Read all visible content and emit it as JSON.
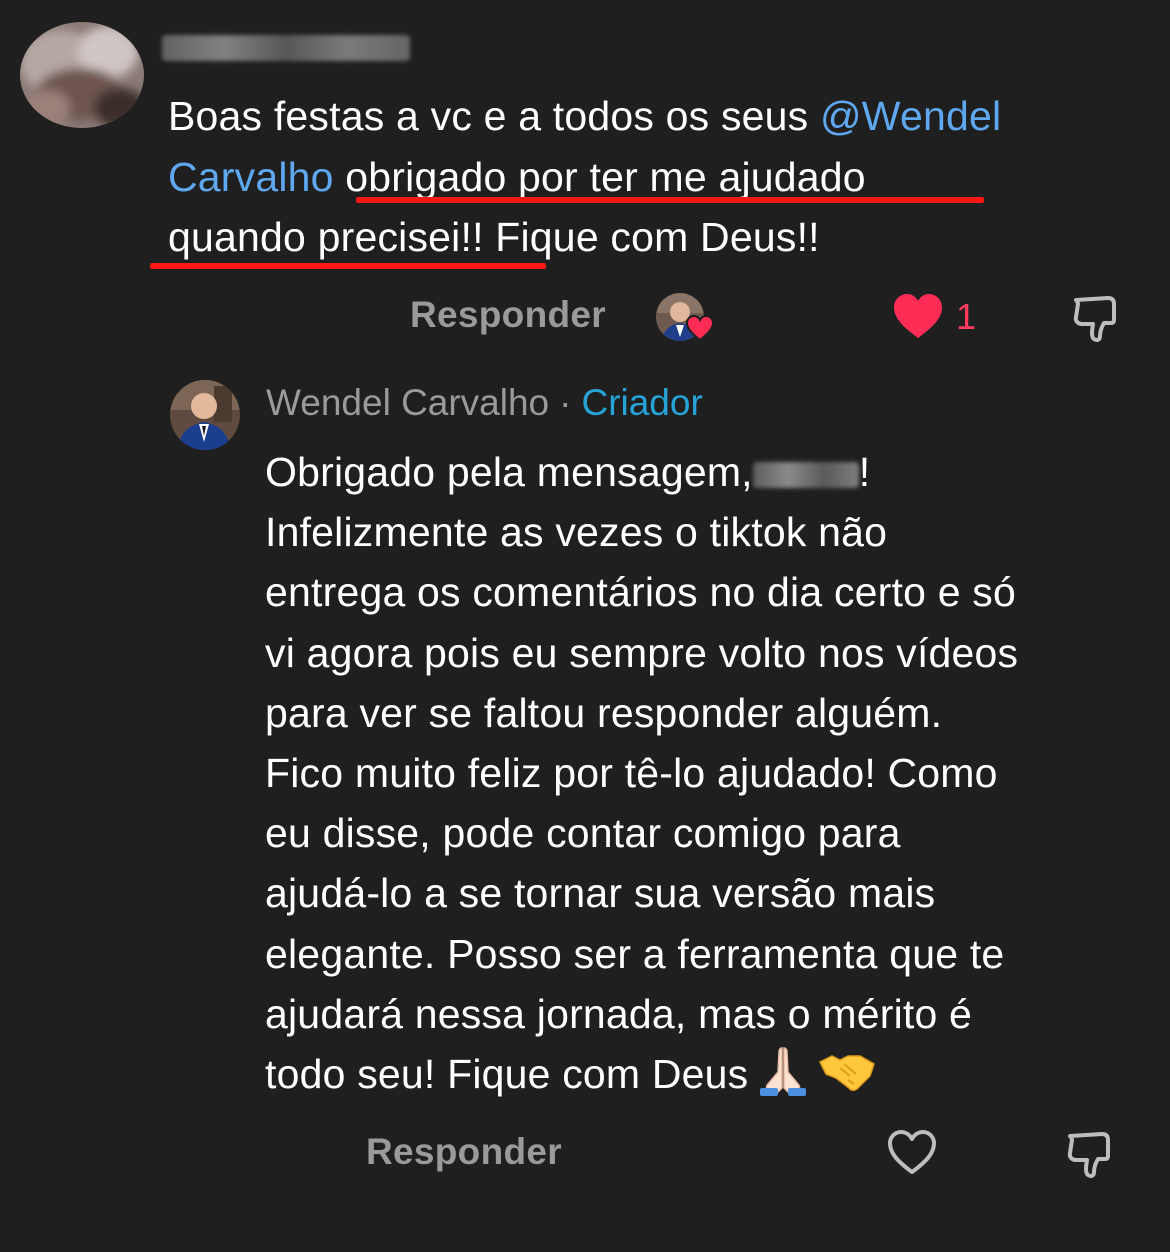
{
  "comment": {
    "line1_text": "Boas festas a vc e a todos os seus ",
    "line1_mention": "@Wendel",
    "line2_mention": "Carvalho",
    "line2_text": " obrigado por ter me ajudado",
    "line3_text": "quando precisei!! Fique com Deus!!",
    "reply_label": "Responder",
    "like_count": "1",
    "highlight_color": "#ff1616",
    "mention_color": "#5fa8f0",
    "like_color": "#ff3b5c"
  },
  "reply": {
    "author": "Wendel Carvalho",
    "separator": "·",
    "badge": "Criador",
    "badge_color": "#27a3d8",
    "line1_before": "Obrigado pela mensagem,",
    "line1_after": "!",
    "lines": [
      "Infelizmente as vezes o tiktok não",
      "entrega os comentários no dia certo e só",
      "vi agora pois eu sempre volto nos vídeos",
      "para ver se faltou responder alguém.",
      "Fico muito feliz por tê-lo ajudado! Como",
      "eu disse, pode contar comigo para",
      "ajudá-lo a se tornar sua versão mais",
      "elegante. Posso ser a ferramenta que te",
      "ajudará nessa jornada, mas o mérito é"
    ],
    "last_line": "todo seu! Fique com Deus",
    "emojis": [
      "praying-hands-icon",
      "handshake-icon"
    ],
    "reply_label": "Responder"
  },
  "icons": {
    "like_filled": "heart-filled-icon",
    "like_outline": "heart-outline-icon",
    "dislike": "thumbs-down-icon"
  }
}
